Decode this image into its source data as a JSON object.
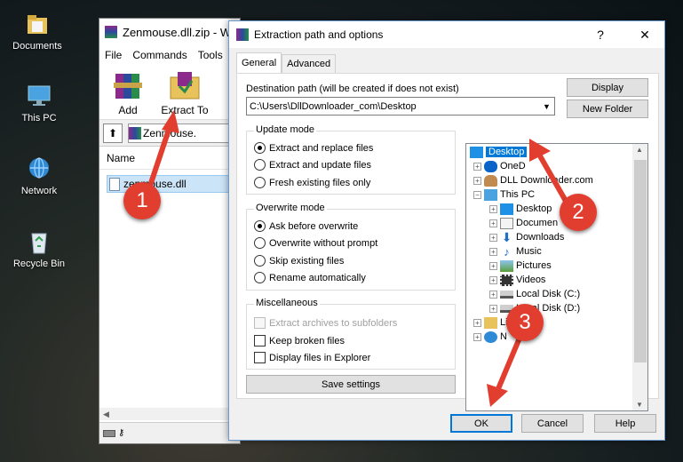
{
  "desktop": {
    "icons": [
      {
        "label": "Documents"
      },
      {
        "label": "This PC"
      },
      {
        "label": "Network"
      },
      {
        "label": "Recycle Bin"
      }
    ]
  },
  "winrar": {
    "title": "Zenmouse.dll.zip - W",
    "menu": [
      "File",
      "Commands",
      "Tools"
    ],
    "toolbar": {
      "add": "Add",
      "extract_to": "Extract To"
    },
    "address": "Zenmouse.",
    "column_name": "Name",
    "file": "zenmouse.dll"
  },
  "dialog": {
    "title": "Extraction path and options",
    "help_glyph": "?",
    "close_glyph": "✕",
    "tabs": [
      "General",
      "Advanced"
    ],
    "dest_label": "Destination path (will be created if does not exist)",
    "dest_value": "C:\\Users\\DllDownloader_com\\Desktop",
    "display_btn": "Display",
    "new_folder_btn": "New Folder",
    "update_mode": {
      "title": "Update mode",
      "options": [
        "Extract and replace files",
        "Extract and update files",
        "Fresh existing files only"
      ],
      "selected": 0
    },
    "overwrite_mode": {
      "title": "Overwrite mode",
      "options": [
        "Ask before overwrite",
        "Overwrite without prompt",
        "Skip existing files",
        "Rename automatically"
      ],
      "selected": 0
    },
    "misc": {
      "title": "Miscellaneous",
      "options": [
        "Extract archives to subfolders",
        "Keep broken files",
        "Display files in Explorer"
      ]
    },
    "save_settings": "Save settings",
    "tree": [
      {
        "label": "Desktop",
        "selected": true
      },
      {
        "label": "OneD"
      },
      {
        "label": "DLL Downloader.com"
      },
      {
        "label": "This PC"
      },
      {
        "label": "Desktop"
      },
      {
        "label": "Documen"
      },
      {
        "label": "Downloads"
      },
      {
        "label": "Music"
      },
      {
        "label": "Pictures"
      },
      {
        "label": "Videos"
      },
      {
        "label": "Local Disk (C:)"
      },
      {
        "label": "Local Disk (D:)"
      },
      {
        "label": "Libraries"
      },
      {
        "label": "N"
      }
    ],
    "ok": "OK",
    "cancel": "Cancel",
    "help": "Help"
  },
  "annotations": [
    "1",
    "2",
    "3"
  ],
  "colors": {
    "badge": "#e23e2f",
    "selection": "#0078d7",
    "folder": "#e8c25a"
  }
}
